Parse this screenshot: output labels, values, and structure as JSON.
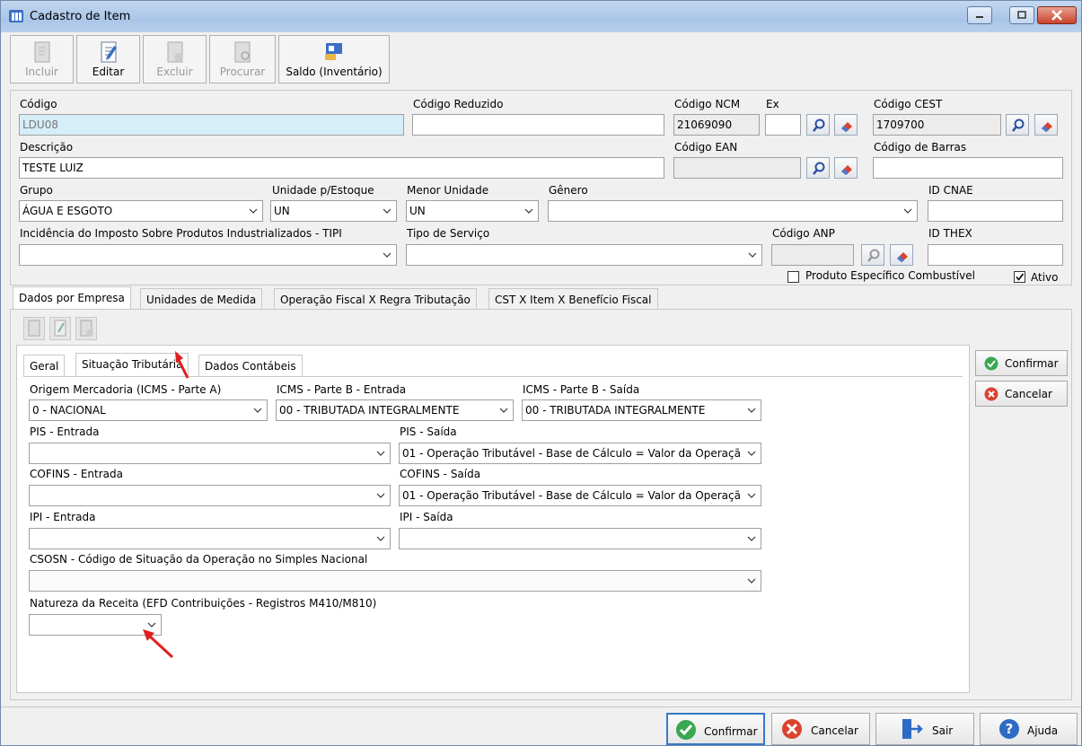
{
  "window": {
    "title": "Cadastro de Item"
  },
  "toolbar": {
    "incluir": "Incluir",
    "editar": "Editar",
    "excluir": "Excluir",
    "procurar": "Procurar",
    "saldo": "Saldo (Inventário)"
  },
  "form": {
    "codigo_label": "Código",
    "codigo_value": "LDU08",
    "codigo_reduzido_label": "Código Reduzido",
    "codigo_reduzido_value": "",
    "ncm_label": "Código NCM",
    "ncm_value": "21069090",
    "ex_label": "Ex",
    "ex_value": "",
    "cest_label": "Código CEST",
    "cest_value": "1709700",
    "descricao_label": "Descrição",
    "descricao_value": "TESTE LUIZ",
    "ean_label": "Código EAN",
    "ean_value": "",
    "barras_label": "Código de Barras",
    "barras_value": "",
    "grupo_label": "Grupo",
    "grupo_value": "ÁGUA E ESGOTO",
    "unidade_label": "Unidade p/Estoque",
    "unidade_value": "UN",
    "menor_label": "Menor Unidade",
    "menor_value": "UN",
    "genero_label": "Gênero",
    "genero_value": "",
    "cnae_label": "ID CNAE",
    "cnae_value": "",
    "tipi_label": "Incidência do Imposto Sobre Produtos Industrializados - TIPI",
    "tipi_value": "",
    "servico_label": "Tipo de Serviço",
    "servico_value": "",
    "anp_label": "Código ANP",
    "anp_value": "",
    "thex_label": "ID THEX",
    "thex_value": "",
    "combustivel_label": "Produto Específico Combustível",
    "combustivel_checked": false,
    "ativo_label": "Ativo",
    "ativo_checked": true
  },
  "tabs": [
    "Dados por Empresa",
    "Unidades de Medida",
    "Operação Fiscal X Regra Tributação",
    "CST X Item X Benefício Fiscal"
  ],
  "subtabs": [
    "Geral",
    "Situação Tributária",
    "Dados Contábeis"
  ],
  "tributaria": {
    "origem_label": "Origem Mercadoria (ICMS - Parte A)",
    "origem_value": "0 - NACIONAL",
    "icms_entrada_label": "ICMS - Parte B - Entrada",
    "icms_entrada_value": "00 - TRIBUTADA INTEGRALMENTE",
    "icms_saida_label": "ICMS - Parte B - Saída",
    "icms_saida_value": "00 - TRIBUTADA INTEGRALMENTE",
    "pis_entrada_label": "PIS - Entrada",
    "pis_entrada_value": "",
    "pis_saida_label": "PIS - Saída",
    "pis_saida_value": "01 - Operação Tributável - Base de Cálculo = Valor da Operaçã",
    "cofins_entrada_label": "COFINS - Entrada",
    "cofins_entrada_value": "",
    "cofins_saida_label": "COFINS - Saída",
    "cofins_saida_value": "01 - Operação Tributável - Base de Cálculo = Valor da Operaçã",
    "ipi_entrada_label": "IPI - Entrada",
    "ipi_entrada_value": "",
    "ipi_saida_label": "IPI - Saída",
    "ipi_saida_value": "",
    "csosn_label": "CSOSN - Código de Situação da Operação no Simples Nacional",
    "csosn_value": "",
    "natureza_label": "Natureza da Receita (EFD Contribuições - Registros M410/M810)",
    "natureza_value": ""
  },
  "side_buttons": {
    "confirmar": "Confirmar",
    "cancelar": "Cancelar"
  },
  "bottom_buttons": {
    "confirmar": "Confirmar",
    "cancelar": "Cancelar",
    "sair": "Sair",
    "ajuda": "Ajuda"
  },
  "colors": {
    "accent_green": "#3aa852",
    "cancel_red": "#d9432f",
    "help_blue": "#2d6bc4",
    "annotation_arrow": "#e02020"
  }
}
